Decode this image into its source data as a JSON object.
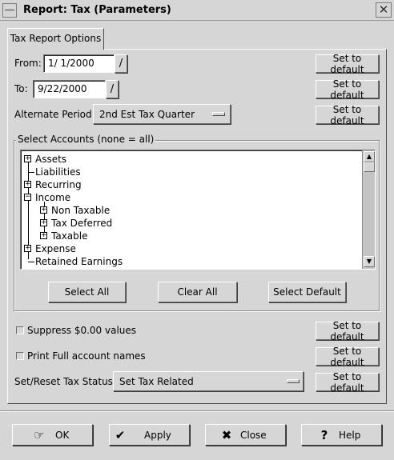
{
  "window": {
    "title": "Report: Tax (Parameters)"
  },
  "tabs": [
    {
      "label": "Tax Report Options"
    }
  ],
  "from": {
    "label": "From:",
    "value": "1/ 1/2000"
  },
  "to": {
    "label": "To:",
    "value": "9/22/2000"
  },
  "alternate_period": {
    "label": "Alternate Period:",
    "selected": "2nd Est Tax Quarter"
  },
  "set_to_default": "Set to default",
  "accounts": {
    "frame_label": "Select Accounts (none = all)",
    "items": [
      {
        "label": "Assets",
        "expandable": true
      },
      {
        "label": "Liabilities",
        "expandable": false
      },
      {
        "label": "Recurring",
        "expandable": true
      },
      {
        "label": "Income",
        "expanded": true
      },
      {
        "label": "Non Taxable",
        "expandable": true
      },
      {
        "label": "Tax Deferred",
        "expandable": true
      },
      {
        "label": "Taxable",
        "expandable": true
      },
      {
        "label": "Expense",
        "expandable": true
      },
      {
        "label": "Retained Earnings",
        "expandable": false
      }
    ],
    "select_all": "Select All",
    "clear_all": "Clear All",
    "select_default": "Select Default"
  },
  "suppress_zero": {
    "label": "Suppress $0.00 values",
    "checked": false
  },
  "print_full_names": {
    "label": "Print Full account names",
    "checked": false
  },
  "tax_status": {
    "label": "Set/Reset Tax Status:",
    "selected": "Set Tax Related"
  },
  "buttons": {
    "ok": "OK",
    "apply": "Apply",
    "close": "Close",
    "help": "Help"
  },
  "icons": {
    "calendar": "calendar-slash-icon",
    "ok": "hand-ok-icon",
    "apply": "checkmark-icon",
    "close": "x-icon",
    "help": "question-mark-icon"
  }
}
